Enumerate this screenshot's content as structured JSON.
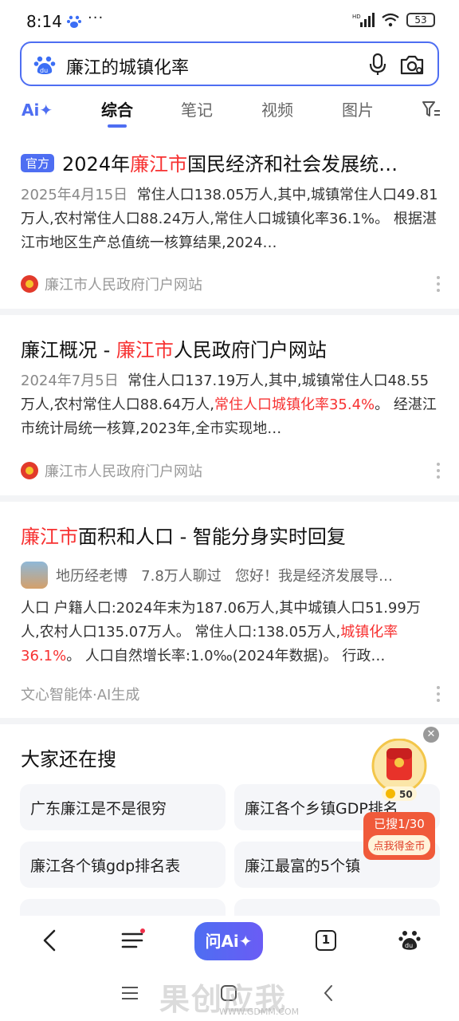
{
  "status_bar": {
    "time": "8:14",
    "dots": "···",
    "battery": "53"
  },
  "search": {
    "query": "廉江的城镇化率"
  },
  "tabs": {
    "ai": "Ai✦",
    "items": [
      "综合",
      "笔记",
      "视频",
      "图片"
    ]
  },
  "results": [
    {
      "tag": "官方",
      "title_pre": "2024年",
      "title_red": "廉江市",
      "title_post": "国民经济和社会发展统…",
      "date": "2025年4月15日",
      "body_1": "常住人口138.05万人,其中,城镇常住人口49.81万人,农村常住人口88.24万人,常住人口城镇化率36.1%。 根据湛江市地区生产总值统一核算结果,2024…",
      "source": "廉江市人民政府门户网站"
    },
    {
      "title_pre": "廉江概况 - ",
      "title_red": "廉江市",
      "title_post": "人民政府门户网站",
      "date": "2024年7月5日",
      "body_1": "常住人口137.19万人,其中,城镇常住人口48.55万人,农村常住人口88.64万人,",
      "body_red": "常住人口城镇化率35.4%",
      "body_2": "。 经湛江市统计局统一核算,2023年,全市实现地…",
      "source": "廉江市人民政府门户网站"
    },
    {
      "title_red": "廉江市",
      "title_post": "面积和人口 - 智能分身实时回复",
      "author": "地历经老博",
      "chats": "7.8万人聊过",
      "greeting": "您好！我是经济发展导…",
      "body_1": "人口 户籍人口:2024年末为187.06万人,其中城镇人口51.99万人,农村人口135.07万人。 常住人口:138.05万人,",
      "body_red": "城镇化率36.1%",
      "body_2": "。 人口自然增长率:1.0‰(2024年数据)。 行政…",
      "source": "文心智能体·AI生成"
    }
  ],
  "related": {
    "title": "大家还在搜",
    "items": [
      "广东廉江是不是很穷",
      "廉江各个乡镇GDP排名",
      "廉江各个镇gdp排名表",
      "廉江最富的5个镇"
    ]
  },
  "reward": {
    "coins": "50",
    "progress": "已搜1/30",
    "cta": "点我得金币"
  },
  "bottom_nav": {
    "ask_ai": "问Ai✦",
    "tab_count": "1"
  },
  "watermark": {
    "text": "果创应我",
    "url": "WWW.GDMM.COM"
  }
}
